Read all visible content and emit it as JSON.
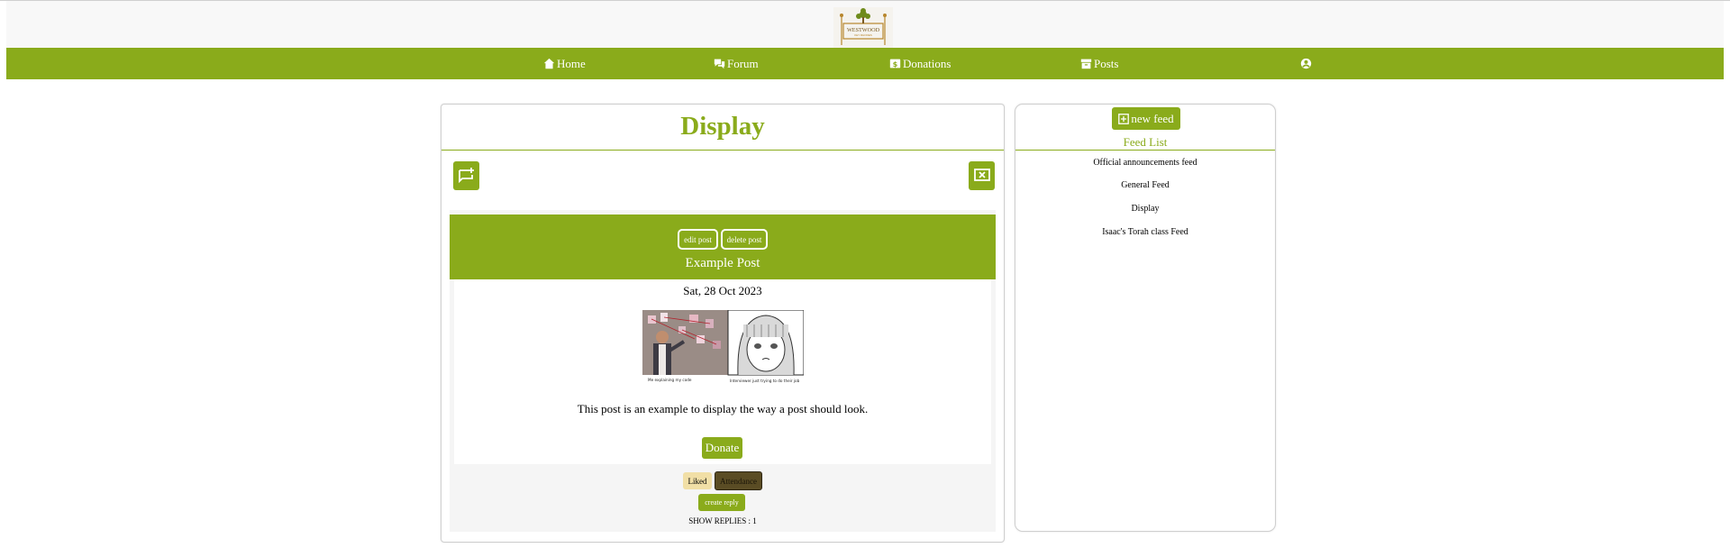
{
  "brand": {
    "logo_text": "WESTWOOD",
    "logo_subtext": "KEY RHODES",
    "accent_color": "#8aab1b"
  },
  "nav": {
    "items": [
      {
        "label": "Home",
        "icon": "home-icon"
      },
      {
        "label": "Forum",
        "icon": "forum-icon"
      },
      {
        "label": "Donations",
        "icon": "donations-icon"
      },
      {
        "label": "Posts",
        "icon": "posts-icon"
      }
    ],
    "profile_icon": "user-circle-icon"
  },
  "display": {
    "title": "Display",
    "add_post_icon": "add-post-icon",
    "close_feed_icon": "close-feed-icon"
  },
  "post": {
    "edit_label": "edit post",
    "delete_label": "delete post",
    "title": "Example Post",
    "date": "Sat, 28 Oct 2023",
    "meme_caption_left": "Me explaining my code",
    "meme_caption_right": "Interviewer just trying to do their job",
    "text": "This post is an example to display the way a post should look.",
    "donate_label": "Donate",
    "liked_label": "Liked",
    "attendance_label": "Attendance",
    "reply_label": "create reply",
    "show_replies_label": "SHOW REPLIES : 1"
  },
  "feeds": {
    "new_feed_label": "new feed",
    "list_title": "Feed List",
    "items": [
      "Official announcements feed",
      "General Feed",
      "Display",
      "Isaac's Torah class Feed"
    ]
  }
}
